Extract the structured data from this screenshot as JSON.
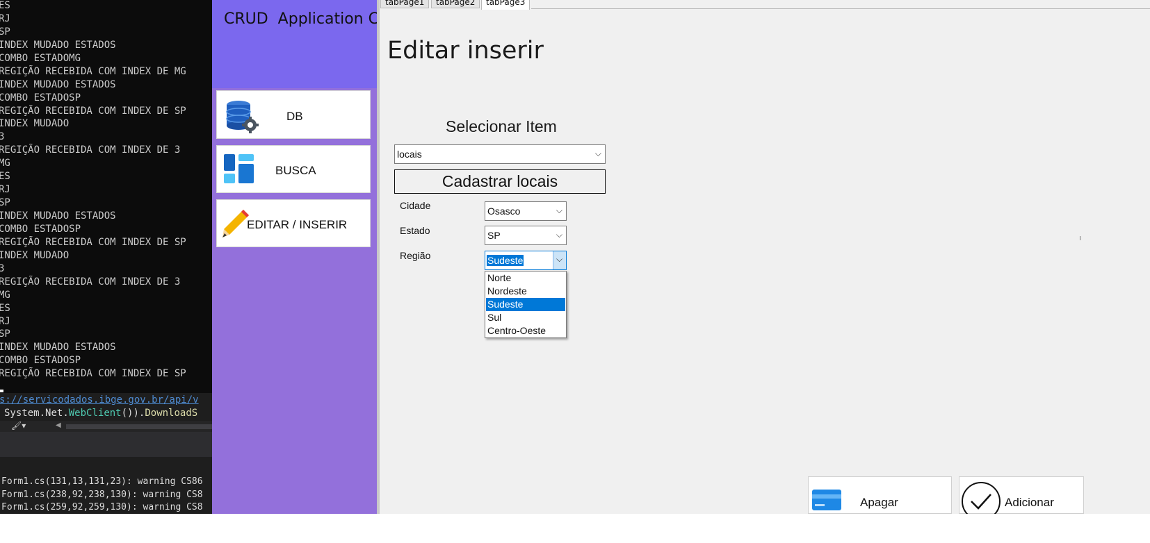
{
  "console": {
    "lines": [
      "ES",
      "RJ",
      "SP",
      "INDEX MUDADO ESTADOS",
      "COMBO ESTADOMG",
      "REGIÇÃO RECEBIDA COM INDEX DE MG",
      "INDEX MUDADO ESTADOS",
      "COMBO ESTADOSP",
      "REGIÇÃO RECEBIDA COM INDEX DE SP",
      "INDEX MUDADO",
      "3",
      "REGIÇÃO RECEBIDA COM INDEX DE 3",
      "MG",
      "ES",
      "RJ",
      "SP",
      "INDEX MUDADO ESTADOS",
      "COMBO ESTADOSP",
      "REGIÇÃO RECEBIDA COM INDEX DE SP",
      "INDEX MUDADO",
      "3",
      "REGIÇÃO RECEBIDA COM INDEX DE 3",
      "MG",
      "ES",
      "RJ",
      "SP",
      "INDEX MUDADO ESTADOS",
      "COMBO ESTADOSP",
      "REGIÇÃO RECEBIDA COM INDEX DE SP"
    ]
  },
  "editor": {
    "url_fragment": "s://servicodados.ibge.gov.br/api/v",
    "code_prefix": "System",
    "code_dot1": ".",
    "code_ns": "Net",
    "code_dot2": ".",
    "code_class": "WebClient",
    "code_parens": "())",
    "code_dot3": ".",
    "code_method": "DownloadS"
  },
  "output": {
    "lines": [
      "Form1.cs(131,13,131,23): warning CS86",
      "Form1.cs(238,92,238,130): warning CS8",
      "Form1.cs(259,92,259,130): warning CS8"
    ]
  },
  "sidebar": {
    "title": "CRUD  Application C#",
    "items": [
      {
        "label": "DB",
        "icon": "database-gear-icon"
      },
      {
        "label": "BUSCA",
        "icon": "dashboard-tiles-icon"
      },
      {
        "label": "EDITAR / INSERIR",
        "icon": "pencil-icon"
      }
    ]
  },
  "tabs": [
    {
      "label": "tabPage1",
      "active": false
    },
    {
      "label": "tabPage2",
      "active": false
    },
    {
      "label": "tabPage3",
      "active": true
    }
  ],
  "form": {
    "title": "Editar inserir",
    "select_heading": "Selecionar Item",
    "item_combo_value": "locais",
    "group_title": "Cadastrar locais",
    "fields": {
      "cidade_label": "Cidade",
      "cidade_value": "Osasco",
      "estado_label": "Estado",
      "estado_value": "SP",
      "regiao_label": "Região",
      "regiao_value": "Sudeste"
    },
    "regiao_options": [
      "Norte",
      "Nordeste",
      "Sudeste",
      "Sul",
      "Centro-Oeste"
    ],
    "regiao_selected": "Sudeste"
  },
  "actions": {
    "delete_label": "Apagar",
    "add_label": "Adicionar"
  },
  "colors": {
    "sidebar": "#9370db",
    "sidebar_header": "#7b68ee",
    "selection": "#0078d7",
    "console_bg": "#0c0c0c"
  }
}
